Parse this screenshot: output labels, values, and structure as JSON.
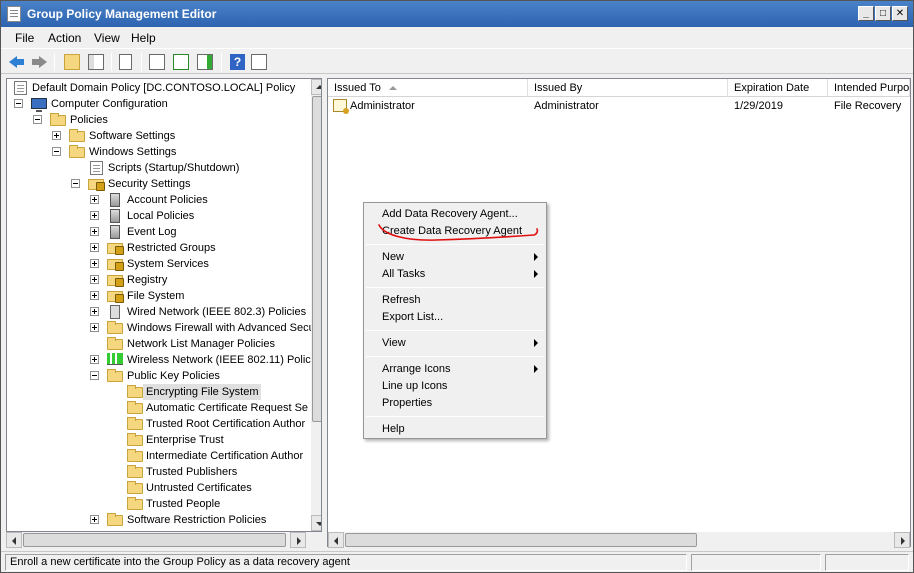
{
  "window": {
    "title": "Group Policy Management Editor",
    "min_glyph": "_",
    "max_glyph": "□",
    "close_glyph": "✕"
  },
  "menubar": {
    "items": [
      {
        "label": "File"
      },
      {
        "label": "Action"
      },
      {
        "label": "View"
      },
      {
        "label": "Help"
      }
    ]
  },
  "toolbar": {
    "help_glyph": "?"
  },
  "tree": {
    "items": [
      {
        "label": "Default Domain Policy [DC.CONTOSO.LOCAL] Policy",
        "icon": "document-icon"
      },
      {
        "label": "Computer Configuration",
        "icon": "computer-icon"
      },
      {
        "label": "Policies",
        "icon": "folder-icon"
      },
      {
        "label": "Software Settings",
        "icon": "folder-icon"
      },
      {
        "label": "Windows Settings",
        "icon": "folder-icon"
      },
      {
        "label": "Scripts (Startup/Shutdown)",
        "icon": "script-icon"
      },
      {
        "label": "Security Settings",
        "icon": "security-icon"
      },
      {
        "label": "Account Policies",
        "icon": "server-icon"
      },
      {
        "label": "Local Policies",
        "icon": "server-icon"
      },
      {
        "label": "Event Log",
        "icon": "server-icon"
      },
      {
        "label": "Restricted Groups",
        "icon": "lock-folder-icon"
      },
      {
        "label": "System Services",
        "icon": "lock-folder-icon"
      },
      {
        "label": "Registry",
        "icon": "lock-folder-icon"
      },
      {
        "label": "File System",
        "icon": "lock-folder-icon"
      },
      {
        "label": "Wired Network (IEEE 802.3) Policies",
        "icon": "network-icon"
      },
      {
        "label": "Windows Firewall with Advanced Secu",
        "icon": "folder-icon"
      },
      {
        "label": "Network List Manager Policies",
        "icon": "folder-icon"
      },
      {
        "label": "Wireless Network (IEEE 802.11) Polici",
        "icon": "signal-icon"
      },
      {
        "label": "Public Key Policies",
        "icon": "folder-icon"
      },
      {
        "label": "Encrypting File System",
        "icon": "folder-icon"
      },
      {
        "label": "Automatic Certificate Request Se",
        "icon": "folder-icon"
      },
      {
        "label": "Trusted Root Certification Author",
        "icon": "folder-icon"
      },
      {
        "label": "Enterprise Trust",
        "icon": "folder-icon"
      },
      {
        "label": "Intermediate Certification Author",
        "icon": "folder-icon"
      },
      {
        "label": "Trusted Publishers",
        "icon": "folder-icon"
      },
      {
        "label": "Untrusted Certificates",
        "icon": "folder-icon"
      },
      {
        "label": "Trusted People",
        "icon": "folder-icon"
      },
      {
        "label": "Software Restriction Policies",
        "icon": "folder-icon"
      }
    ]
  },
  "list": {
    "columns": [
      {
        "label": "Issued To"
      },
      {
        "label": "Issued By"
      },
      {
        "label": "Expiration Date"
      },
      {
        "label": "Intended Purpo"
      }
    ],
    "rows": [
      {
        "issued_to": "Administrator",
        "issued_by": "Administrator",
        "expiration": "1/29/2019",
        "purpose": "File Recovery"
      }
    ]
  },
  "context_menu": {
    "items": [
      {
        "label": "Add Data Recovery Agent..."
      },
      {
        "label": "Create Data Recovery Agent"
      },
      {
        "label": "New"
      },
      {
        "label": "All Tasks"
      },
      {
        "label": "Refresh"
      },
      {
        "label": "Export List..."
      },
      {
        "label": "View"
      },
      {
        "label": "Arrange Icons"
      },
      {
        "label": "Line up Icons"
      },
      {
        "label": "Properties"
      },
      {
        "label": "Help"
      }
    ],
    "annotation_color": "#e01010"
  },
  "statusbar": {
    "text": "Enroll a new certificate into the Group Policy as a data recovery agent"
  },
  "colors": {
    "titlebar": "#2d63b0",
    "selected_bg": "#e0e0e0",
    "accent_blue": "#2d7fd4"
  }
}
